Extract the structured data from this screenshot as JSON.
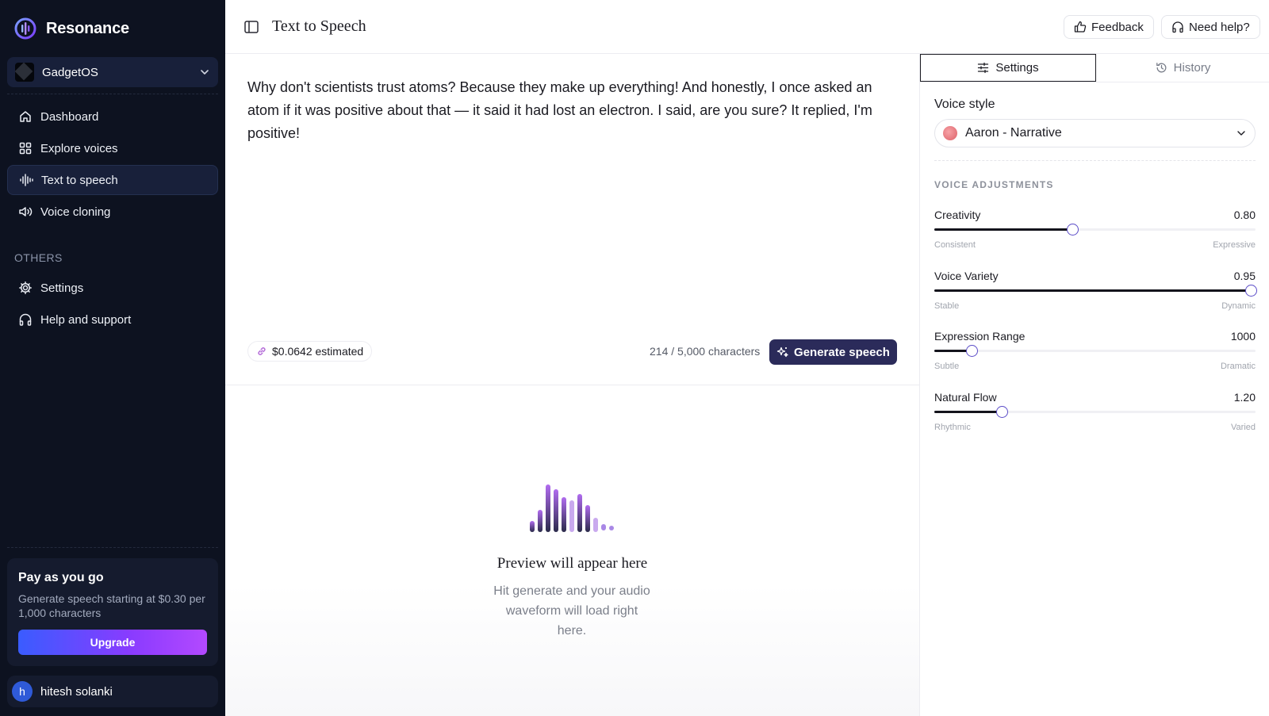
{
  "brand": {
    "name": "Resonance"
  },
  "org": {
    "name": "GadgetOS"
  },
  "nav": {
    "items": [
      {
        "label": "Dashboard",
        "icon": "home-icon"
      },
      {
        "label": "Explore voices",
        "icon": "grid-icon"
      },
      {
        "label": "Text to speech",
        "icon": "waveform-icon",
        "active": true
      },
      {
        "label": "Voice cloning",
        "icon": "speaker-icon"
      }
    ],
    "section_label": "OTHERS",
    "other_items": [
      {
        "label": "Settings",
        "icon": "gear-icon"
      },
      {
        "label": "Help and support",
        "icon": "headphones-icon"
      }
    ]
  },
  "promo": {
    "title": "Pay as you go",
    "description": "Generate speech starting at $0.30 per 1,000 characters",
    "button": "Upgrade"
  },
  "user": {
    "initial": "h",
    "name": "hitesh solanki"
  },
  "topbar": {
    "title": "Text to Speech",
    "feedback": "Feedback",
    "help": "Need help?"
  },
  "editor": {
    "text": "Why don't scientists trust atoms? Because they make up everything! And honestly, I once asked an atom if it was positive about that — it said it had lost an electron. I said, are you sure? It replied, I'm positive!",
    "cost": "$0.0642 estimated",
    "count": "214 / 5,000 characters",
    "generate": "Generate speech"
  },
  "preview": {
    "title": "Preview will appear here",
    "subtitle": "Hit generate and your audio waveform will load right here."
  },
  "panel": {
    "tabs": {
      "settings": "Settings",
      "history": "History"
    },
    "voice_style_label": "Voice style",
    "voice_style_value": "Aaron - Narrative",
    "adjustments_label": "VOICE ADJUSTMENTS",
    "sliders": [
      {
        "name": "Creativity",
        "value": "0.80",
        "fraction": 0.43,
        "min": "Consistent",
        "max": "Expressive"
      },
      {
        "name": "Voice Variety",
        "value": "0.95",
        "fraction": 0.985,
        "min": "Stable",
        "max": "Dynamic"
      },
      {
        "name": "Expression Range",
        "value": "1000",
        "fraction": 0.115,
        "min": "Subtle",
        "max": "Dramatic"
      },
      {
        "name": "Natural Flow",
        "value": "1.20",
        "fraction": 0.21,
        "min": "Rhythmic",
        "max": "Varied"
      }
    ]
  },
  "colors": {
    "sidebar_bg": "#0d1220",
    "accent": "#5b4cc8",
    "generate_bg": "#2b2b5a"
  }
}
